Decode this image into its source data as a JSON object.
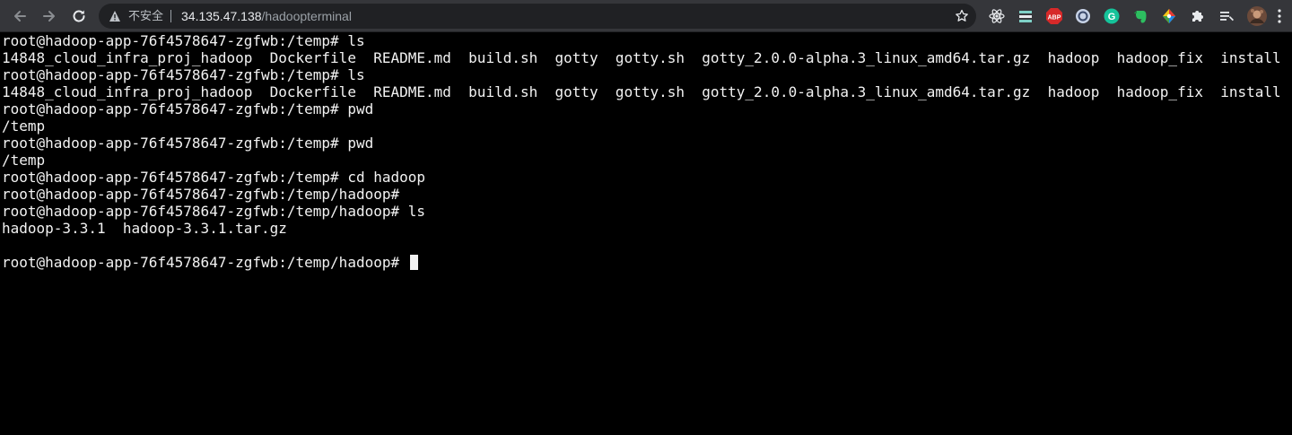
{
  "browser": {
    "insecure_label": "不安全",
    "url_host": "34.135.47.138",
    "url_path": "/hadoopterminal",
    "extensions": [
      "react-devtools-icon",
      "shelf-extension-icon",
      "adblock-plus-icon",
      "circle-extension-icon",
      "grammarly-icon",
      "evernote-icon",
      "color-picker-icon",
      "puzzle-extensions-icon",
      "reading-list-icon",
      "profile-avatar"
    ],
    "abp_label": "ABP",
    "grammarly_label": "G"
  },
  "terminal": {
    "lines": [
      "root@hadoop-app-76f4578647-zgfwb:/temp# ls",
      "14848_cloud_infra_proj_hadoop  Dockerfile  README.md  build.sh  gotty  gotty.sh  gotty_2.0.0-alpha.3_linux_amd64.tar.gz  hadoop  hadoop_fix  install",
      "root@hadoop-app-76f4578647-zgfwb:/temp# ls",
      "14848_cloud_infra_proj_hadoop  Dockerfile  README.md  build.sh  gotty  gotty.sh  gotty_2.0.0-alpha.3_linux_amd64.tar.gz  hadoop  hadoop_fix  install",
      "root@hadoop-app-76f4578647-zgfwb:/temp# pwd",
      "/temp",
      "root@hadoop-app-76f4578647-zgfwb:/temp# pwd",
      "/temp",
      "root@hadoop-app-76f4578647-zgfwb:/temp# cd hadoop",
      "root@hadoop-app-76f4578647-zgfwb:/temp/hadoop#",
      "root@hadoop-app-76f4578647-zgfwb:/temp/hadoop# ls",
      "hadoop-3.3.1  hadoop-3.3.1.tar.gz",
      "",
      "root@hadoop-app-76f4578647-zgfwb:/temp/hadoop# "
    ]
  },
  "colors": {
    "toolbar": "#35363a",
    "omnibox": "#202124",
    "terminal_bg": "#000000",
    "terminal_fg": "#f2f2f2"
  }
}
